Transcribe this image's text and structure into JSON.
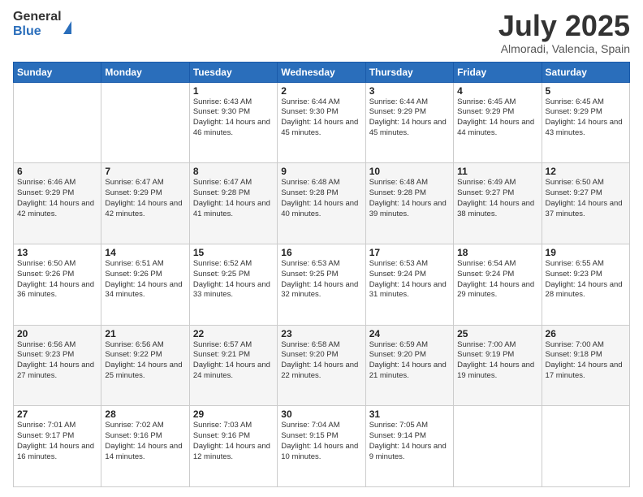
{
  "logo": {
    "general": "General",
    "blue": "Blue"
  },
  "title": {
    "month_year": "July 2025",
    "location": "Almoradi, Valencia, Spain"
  },
  "weekdays": [
    "Sunday",
    "Monday",
    "Tuesday",
    "Wednesday",
    "Thursday",
    "Friday",
    "Saturday"
  ],
  "weeks": [
    [
      {
        "day": "",
        "info": ""
      },
      {
        "day": "",
        "info": ""
      },
      {
        "day": "1",
        "info": "Sunrise: 6:43 AM\nSunset: 9:30 PM\nDaylight: 14 hours and 46 minutes."
      },
      {
        "day": "2",
        "info": "Sunrise: 6:44 AM\nSunset: 9:30 PM\nDaylight: 14 hours and 45 minutes."
      },
      {
        "day": "3",
        "info": "Sunrise: 6:44 AM\nSunset: 9:29 PM\nDaylight: 14 hours and 45 minutes."
      },
      {
        "day": "4",
        "info": "Sunrise: 6:45 AM\nSunset: 9:29 PM\nDaylight: 14 hours and 44 minutes."
      },
      {
        "day": "5",
        "info": "Sunrise: 6:45 AM\nSunset: 9:29 PM\nDaylight: 14 hours and 43 minutes."
      }
    ],
    [
      {
        "day": "6",
        "info": "Sunrise: 6:46 AM\nSunset: 9:29 PM\nDaylight: 14 hours and 42 minutes."
      },
      {
        "day": "7",
        "info": "Sunrise: 6:47 AM\nSunset: 9:29 PM\nDaylight: 14 hours and 42 minutes."
      },
      {
        "day": "8",
        "info": "Sunrise: 6:47 AM\nSunset: 9:28 PM\nDaylight: 14 hours and 41 minutes."
      },
      {
        "day": "9",
        "info": "Sunrise: 6:48 AM\nSunset: 9:28 PM\nDaylight: 14 hours and 40 minutes."
      },
      {
        "day": "10",
        "info": "Sunrise: 6:48 AM\nSunset: 9:28 PM\nDaylight: 14 hours and 39 minutes."
      },
      {
        "day": "11",
        "info": "Sunrise: 6:49 AM\nSunset: 9:27 PM\nDaylight: 14 hours and 38 minutes."
      },
      {
        "day": "12",
        "info": "Sunrise: 6:50 AM\nSunset: 9:27 PM\nDaylight: 14 hours and 37 minutes."
      }
    ],
    [
      {
        "day": "13",
        "info": "Sunrise: 6:50 AM\nSunset: 9:26 PM\nDaylight: 14 hours and 36 minutes."
      },
      {
        "day": "14",
        "info": "Sunrise: 6:51 AM\nSunset: 9:26 PM\nDaylight: 14 hours and 34 minutes."
      },
      {
        "day": "15",
        "info": "Sunrise: 6:52 AM\nSunset: 9:25 PM\nDaylight: 14 hours and 33 minutes."
      },
      {
        "day": "16",
        "info": "Sunrise: 6:53 AM\nSunset: 9:25 PM\nDaylight: 14 hours and 32 minutes."
      },
      {
        "day": "17",
        "info": "Sunrise: 6:53 AM\nSunset: 9:24 PM\nDaylight: 14 hours and 31 minutes."
      },
      {
        "day": "18",
        "info": "Sunrise: 6:54 AM\nSunset: 9:24 PM\nDaylight: 14 hours and 29 minutes."
      },
      {
        "day": "19",
        "info": "Sunrise: 6:55 AM\nSunset: 9:23 PM\nDaylight: 14 hours and 28 minutes."
      }
    ],
    [
      {
        "day": "20",
        "info": "Sunrise: 6:56 AM\nSunset: 9:23 PM\nDaylight: 14 hours and 27 minutes."
      },
      {
        "day": "21",
        "info": "Sunrise: 6:56 AM\nSunset: 9:22 PM\nDaylight: 14 hours and 25 minutes."
      },
      {
        "day": "22",
        "info": "Sunrise: 6:57 AM\nSunset: 9:21 PM\nDaylight: 14 hours and 24 minutes."
      },
      {
        "day": "23",
        "info": "Sunrise: 6:58 AM\nSunset: 9:20 PM\nDaylight: 14 hours and 22 minutes."
      },
      {
        "day": "24",
        "info": "Sunrise: 6:59 AM\nSunset: 9:20 PM\nDaylight: 14 hours and 21 minutes."
      },
      {
        "day": "25",
        "info": "Sunrise: 7:00 AM\nSunset: 9:19 PM\nDaylight: 14 hours and 19 minutes."
      },
      {
        "day": "26",
        "info": "Sunrise: 7:00 AM\nSunset: 9:18 PM\nDaylight: 14 hours and 17 minutes."
      }
    ],
    [
      {
        "day": "27",
        "info": "Sunrise: 7:01 AM\nSunset: 9:17 PM\nDaylight: 14 hours and 16 minutes."
      },
      {
        "day": "28",
        "info": "Sunrise: 7:02 AM\nSunset: 9:16 PM\nDaylight: 14 hours and 14 minutes."
      },
      {
        "day": "29",
        "info": "Sunrise: 7:03 AM\nSunset: 9:16 PM\nDaylight: 14 hours and 12 minutes."
      },
      {
        "day": "30",
        "info": "Sunrise: 7:04 AM\nSunset: 9:15 PM\nDaylight: 14 hours and 10 minutes."
      },
      {
        "day": "31",
        "info": "Sunrise: 7:05 AM\nSunset: 9:14 PM\nDaylight: 14 hours and 9 minutes."
      },
      {
        "day": "",
        "info": ""
      },
      {
        "day": "",
        "info": ""
      }
    ]
  ]
}
